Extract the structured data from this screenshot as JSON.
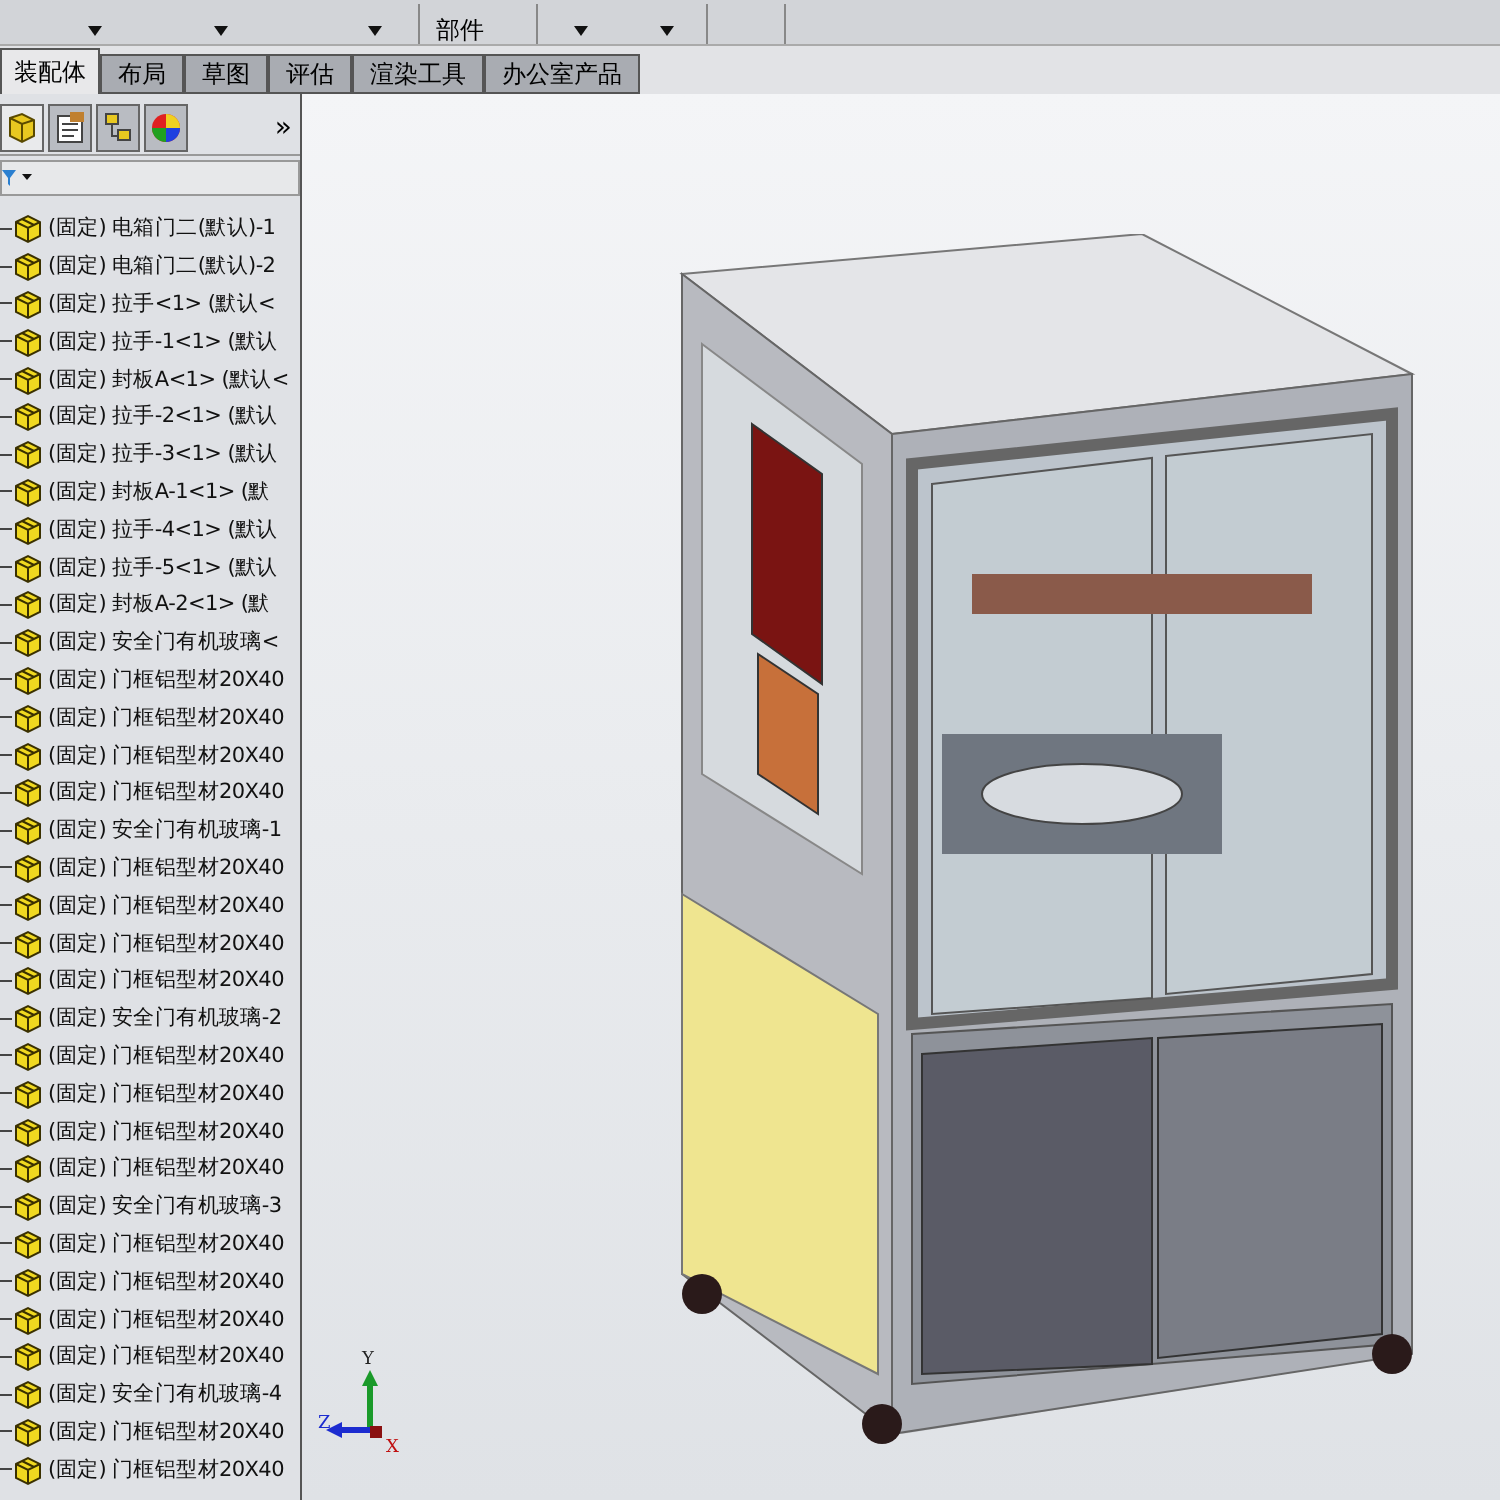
{
  "toolbar": {
    "label": "部件"
  },
  "tabs": [
    {
      "label": "装配体",
      "selected": true
    },
    {
      "label": "布局",
      "selected": false
    },
    {
      "label": "草图",
      "selected": false
    },
    {
      "label": "评估",
      "selected": false
    },
    {
      "label": "渲染工具",
      "selected": false
    },
    {
      "label": "办公室产品",
      "selected": false
    }
  ],
  "panel_tabs": [
    {
      "kind": "tree",
      "selected": true
    },
    {
      "kind": "property",
      "selected": false
    },
    {
      "kind": "config",
      "selected": false
    },
    {
      "kind": "appearance",
      "selected": false
    }
  ],
  "panel_more": "»",
  "tree": {
    "items": [
      {
        "prefix": "(固定)",
        "name": "电箱门二(默认)-1"
      },
      {
        "prefix": "(固定)",
        "name": "电箱门二(默认)-2"
      },
      {
        "prefix": "(固定)",
        "name": "拉手<1> (默认<"
      },
      {
        "prefix": "(固定)",
        "name": "拉手-1<1> (默认"
      },
      {
        "prefix": "(固定)",
        "name": "封板A<1> (默认<"
      },
      {
        "prefix": "(固定)",
        "name": "拉手-2<1> (默认"
      },
      {
        "prefix": "(固定)",
        "name": "拉手-3<1> (默认"
      },
      {
        "prefix": "(固定)",
        "name": "封板A-1<1> (默"
      },
      {
        "prefix": "(固定)",
        "name": "拉手-4<1> (默认"
      },
      {
        "prefix": "(固定)",
        "name": "拉手-5<1> (默认"
      },
      {
        "prefix": "(固定)",
        "name": "封板A-2<1> (默"
      },
      {
        "prefix": "(固定)",
        "name": "安全门有机玻璃<"
      },
      {
        "prefix": "(固定)",
        "name": "门框铝型材20X40"
      },
      {
        "prefix": "(固定)",
        "name": "门框铝型材20X40"
      },
      {
        "prefix": "(固定)",
        "name": "门框铝型材20X40"
      },
      {
        "prefix": "(固定)",
        "name": "门框铝型材20X40"
      },
      {
        "prefix": "(固定)",
        "name": "安全门有机玻璃-1"
      },
      {
        "prefix": "(固定)",
        "name": "门框铝型材20X40"
      },
      {
        "prefix": "(固定)",
        "name": "门框铝型材20X40"
      },
      {
        "prefix": "(固定)",
        "name": "门框铝型材20X40"
      },
      {
        "prefix": "(固定)",
        "name": "门框铝型材20X40"
      },
      {
        "prefix": "(固定)",
        "name": "安全门有机玻璃-2"
      },
      {
        "prefix": "(固定)",
        "name": "门框铝型材20X40"
      },
      {
        "prefix": "(固定)",
        "name": "门框铝型材20X40"
      },
      {
        "prefix": "(固定)",
        "name": "门框铝型材20X40"
      },
      {
        "prefix": "(固定)",
        "name": "门框铝型材20X40"
      },
      {
        "prefix": "(固定)",
        "name": "安全门有机玻璃-3"
      },
      {
        "prefix": "(固定)",
        "name": "门框铝型材20X40"
      },
      {
        "prefix": "(固定)",
        "name": "门框铝型材20X40"
      },
      {
        "prefix": "(固定)",
        "name": "门框铝型材20X40"
      },
      {
        "prefix": "(固定)",
        "name": "门框铝型材20X40"
      },
      {
        "prefix": "(固定)",
        "name": "安全门有机玻璃-4"
      },
      {
        "prefix": "(固定)",
        "name": "门框铝型材20X40"
      },
      {
        "prefix": "(固定)",
        "name": "门框铝型材20X40"
      }
    ]
  },
  "axes": {
    "y": "Y",
    "z": "Z",
    "x": "X"
  }
}
